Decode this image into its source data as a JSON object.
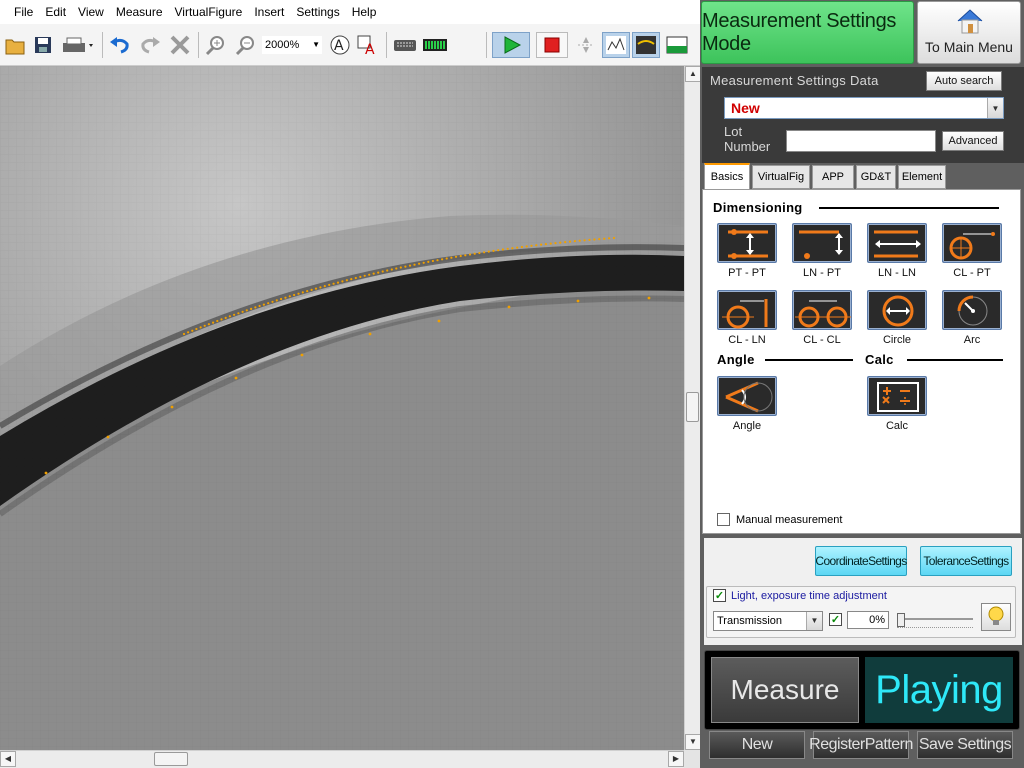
{
  "menu": [
    "File",
    "Edit",
    "View",
    "Measure",
    "VirtualFigure",
    "Insert",
    "Settings",
    "Help"
  ],
  "toolbar": {
    "zoom": "2000%"
  },
  "header": {
    "mode_label": "Measurement Settings Mode",
    "main_menu_label": "To Main Menu"
  },
  "settings_data": {
    "title": "Measurement Settings Data",
    "auto_search": "Auto search",
    "selected": "New",
    "lot_label_line1": "Lot",
    "lot_label_line2": "Number",
    "lot_value": "",
    "advanced": "Advanced"
  },
  "tabs": [
    "Basics",
    "VirtualFig",
    "APP",
    "GD&T",
    "Element"
  ],
  "basics": {
    "dimensioning_heading": "Dimensioning",
    "dimensioning_items": [
      "PT - PT",
      "LN - PT",
      "LN - LN",
      "CL - PT",
      "CL - LN",
      "CL - CL",
      "Circle",
      "Arc"
    ],
    "angle_heading": "Angle",
    "calc_heading": "Calc",
    "angle_item": "Angle",
    "calc_item": "Calc",
    "manual_label": "Manual measurement"
  },
  "settings_buttons": {
    "coordinate": "CoordinateSettings",
    "tolerance": "ToleranceSettings"
  },
  "light": {
    "label": "Light, exposure time adjustment",
    "mode": "Transmission",
    "value": "0%"
  },
  "bottom": {
    "measure": "Measure",
    "status": "Playing",
    "new": "New",
    "register": "RegisterPattern",
    "save": "Save Settings"
  },
  "colors": {
    "mode_green": "#4fd06c",
    "playing_cyan": "#2ee8f8",
    "new_red": "#d00000",
    "tab_accent": "#ff9a00",
    "icon_orange": "#f07a1a"
  }
}
